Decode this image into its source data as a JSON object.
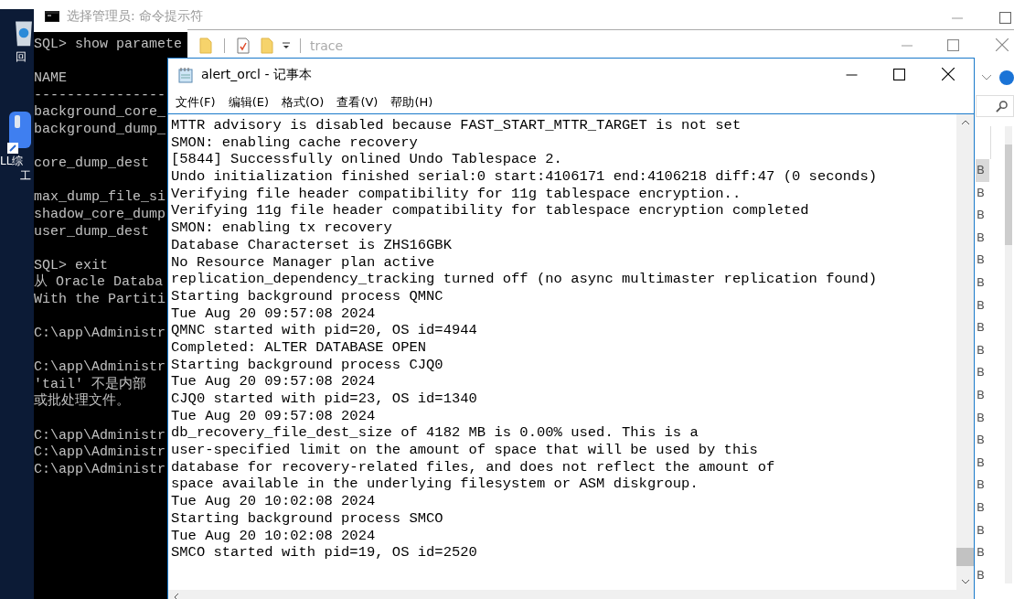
{
  "desktop": {
    "icons": [
      {
        "kind": "recycle",
        "lines": [
          "回"
        ]
      },
      {
        "kind": "app",
        "lines": [
          "LL综",
          "工"
        ]
      }
    ]
  },
  "console_window": {
    "title": "选择管理员: 命令提示符",
    "blocks": [
      [
        "SQL> show paramete"
      ],
      [
        "NAME",
        "----------------",
        "background_core_",
        "background_dump_"
      ],
      [
        "core_dump_dest"
      ],
      [
        "max_dump_file_si",
        "shadow_core_dump",
        "user_dump_dest"
      ],
      [
        "SQL> exit",
        "从 Oracle Databa",
        "With the Partiti"
      ],
      [
        "C:\\app\\Administr"
      ],
      [
        "C:\\app\\Administr",
        "'tail' 不是内部",
        "或批处理文件。"
      ],
      [
        "C:\\app\\Administr",
        "C:\\app\\Administr",
        "C:\\app\\Administr"
      ]
    ]
  },
  "explorer_window": {
    "title": "trace",
    "rows": [
      {
        "size": "B",
        "selected": true
      },
      {
        "size": "B",
        "selected": false
      },
      {
        "size": "B",
        "selected": false
      },
      {
        "size": "B",
        "selected": false
      },
      {
        "size": "B",
        "selected": false
      },
      {
        "size": "B",
        "selected": false
      },
      {
        "size": "B",
        "selected": false
      },
      {
        "size": "B",
        "selected": false
      },
      {
        "size": "B",
        "selected": false
      },
      {
        "size": "B",
        "selected": false
      },
      {
        "size": "B",
        "selected": false
      },
      {
        "size": "B",
        "selected": false
      },
      {
        "size": "B",
        "selected": false
      },
      {
        "size": "B",
        "selected": false
      },
      {
        "size": "B",
        "selected": false
      },
      {
        "size": "B",
        "selected": false
      },
      {
        "size": "B",
        "selected": false
      },
      {
        "size": "B",
        "selected": false
      },
      {
        "size": "B",
        "selected": false
      }
    ]
  },
  "notepad_window": {
    "title": "alert_orcl - 记事本",
    "menu": [
      "文件(F)",
      "编辑(E)",
      "格式(O)",
      "查看(V)",
      "帮助(H)"
    ],
    "lines": [
      "MTTR advisory is disabled because FAST_START_MTTR_TARGET is not set",
      "SMON: enabling cache recovery",
      "[5844] Successfully onlined Undo Tablespace 2.",
      "Undo initialization finished serial:0 start:4106171 end:4106218 diff:47 (0 seconds)",
      "Verifying file header compatibility for 11g tablespace encryption..",
      "Verifying 11g file header compatibility for tablespace encryption completed",
      "SMON: enabling tx recovery",
      "Database Characterset is ZHS16GBK",
      "No Resource Manager plan active",
      "replication_dependency_tracking turned off (no async multimaster replication found)",
      "Starting background process QMNC",
      "Tue Aug 20 09:57:08 2024",
      "QMNC started with pid=20, OS id=4944",
      "Completed: ALTER DATABASE OPEN",
      "Starting background process CJQ0",
      "Tue Aug 20 09:57:08 2024",
      "CJQ0 started with pid=23, OS id=1340",
      "Tue Aug 20 09:57:08 2024",
      "db_recovery_file_dest_size of 4182 MB is 0.00% used. This is a",
      "user-specified limit on the amount of space that will be used by this",
      "database for recovery-related files, and does not reflect the amount of",
      "space available in the underlying filesystem or ASM diskgroup.",
      "Tue Aug 20 10:02:08 2024",
      "Starting background process SMCO",
      "Tue Aug 20 10:02:08 2024",
      "SMCO started with pid=19, OS id=2520"
    ]
  }
}
